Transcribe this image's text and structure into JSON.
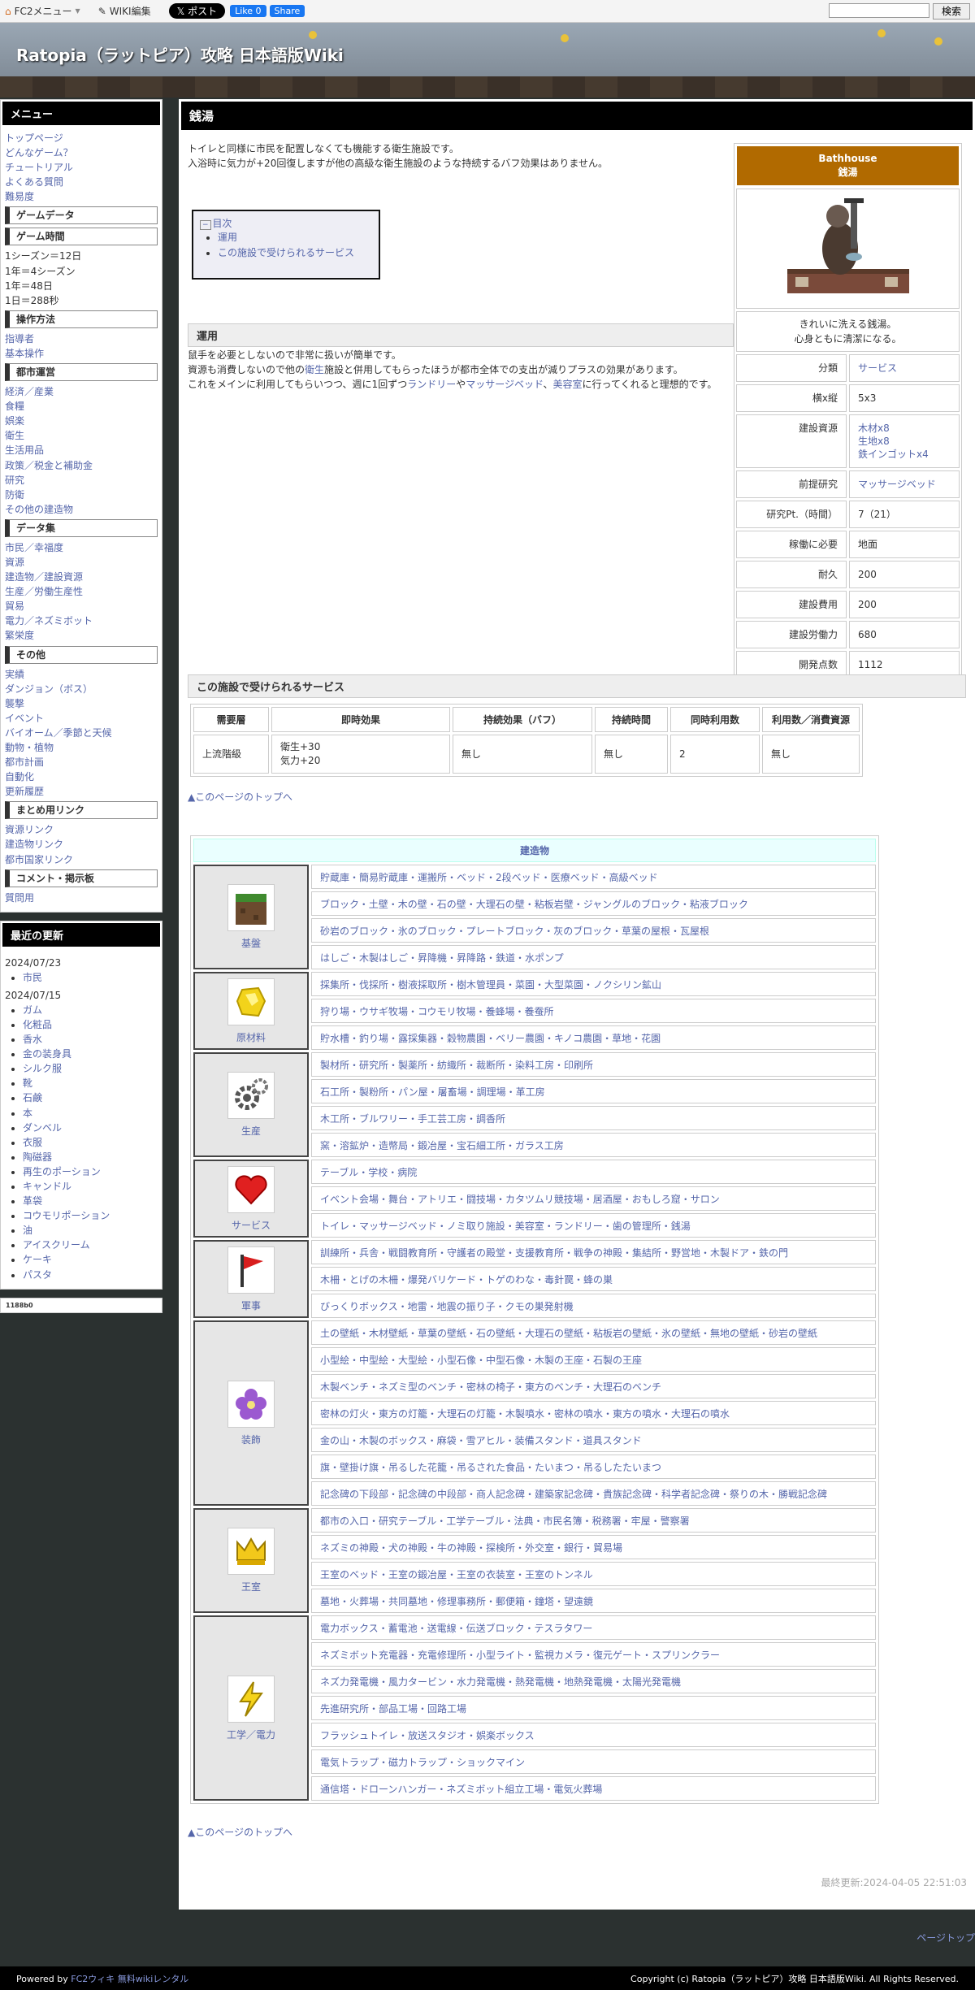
{
  "topbar": {
    "fc2_menu": "FC2メニュー",
    "wiki_edit": "WIKI編集",
    "x_post": "𝕏 ポスト",
    "fb_like": "Like 0",
    "fb_share": "Share",
    "search_button": "検索",
    "search_placeholder": ""
  },
  "site": {
    "title": "Ratopia（ラットピア）攻略 日本語版Wiki"
  },
  "sidebar": {
    "menu_title": "メニュー",
    "groups": [
      {
        "heading": "",
        "items": [
          "トップページ",
          "どんなゲーム？",
          "チュートリアル",
          "よくある質問",
          "難易度"
        ]
      },
      {
        "heading": "ゲームデータ",
        "items": []
      },
      {
        "heading": "ゲーム時間",
        "plain": [
          "1シーズン＝12日",
          "1年＝4シーズン",
          "1年＝48日",
          "1日＝288秒"
        ]
      },
      {
        "heading": "操作方法",
        "items": [
          "指導者",
          "基本操作"
        ]
      },
      {
        "heading": "都市運営",
        "items": [
          "経済／産業",
          "食糧",
          "娯楽",
          "衛生",
          "生活用品",
          "政策／税金と補助金",
          "研究",
          "防衛",
          "その他の建造物"
        ]
      },
      {
        "heading": "データ集",
        "items": [
          "市民／幸福度",
          "資源",
          "建造物／建設資源",
          "生産／労働生産性",
          "貿易",
          "電力／ネズミボット",
          "繁栄度"
        ]
      },
      {
        "heading": "その他",
        "items": [
          "実績",
          "ダンジョン（ボス）",
          "襲撃",
          "イベント",
          "バイオーム／季節と天候",
          "動物・植物",
          "都市計画",
          "自動化",
          "更新履歴"
        ]
      },
      {
        "heading": "まとめ用リンク",
        "items": [
          "資源リンク",
          "建造物リンク",
          "都市国家リンク"
        ]
      },
      {
        "heading": "コメント・掲示板",
        "items": [
          "質問用"
        ]
      }
    ],
    "updates_title": "最近の更新",
    "updates": [
      {
        "date": "2024/07/23",
        "items": [
          "市民"
        ]
      },
      {
        "date": "2024/07/15",
        "items": [
          "ガム",
          "化粧品",
          "香水",
          "金の装身具",
          "シルク服",
          "靴",
          "石鹸",
          "本",
          "ダンベル",
          "衣服",
          "陶磁器",
          "再生のポーション",
          "キャンドル",
          "革袋",
          "コウモリポーション",
          "油",
          "アイスクリーム",
          "ケーキ",
          "パスタ"
        ]
      }
    ],
    "counter": "1188b0"
  },
  "page": {
    "title": "銭湯",
    "intro": [
      "トイレと同様に市民を配置しなくても機能する衛生施設です。",
      "入浴時に気力が+20回復しますが他の高級な衛生施設のような持続するバフ効果はありません。"
    ],
    "toc_label": "目次",
    "toc": [
      "運用",
      "この施設で受けられるサービス"
    ],
    "sec1_title": "運用",
    "sec1_lines": [
      {
        "pre": "鼠手を必要としないので非常に扱いが簡単です。",
        "link": "",
        "post": ""
      },
      {
        "pre": "資源も消費しないので他の",
        "link": "衛生",
        "post": "施設と併用してもらったほうが都市全体での支出が減りプラスの効果があります。"
      }
    ],
    "sec1_line3": {
      "a": "これをメインに利用してもらいつつ、週に1回ずつ",
      "b": "ランドリー",
      "c": "や",
      "d": "マッサージベッド",
      "e": "、",
      "f": "美容室",
      "g": "に行ってくれると理想的です。"
    },
    "sec2_title": "この施設で受けられるサービス",
    "back_to_top": "▲このページのトップへ",
    "last_modified": "最終更新:2024-04-05 22:51:03"
  },
  "infobox": {
    "title_en": "Bathhouse",
    "title_jp": "銭湯",
    "desc": [
      "きれいに洗える銭湯。",
      "心身ともに清潔になる。"
    ],
    "rows": [
      {
        "k": "分類",
        "v": "サービス",
        "link": true
      },
      {
        "k": "横x縦",
        "v": "5x3",
        "link": false
      },
      {
        "k": "建設資源",
        "v": "木材x8\n生地x8\n鉄インゴットx4",
        "link": true
      },
      {
        "k": "前提研究",
        "v": "マッサージベッド",
        "link": true
      },
      {
        "k": "研究Pt.（時間）",
        "v": "7（21）",
        "link": false
      },
      {
        "k": "稼働に必要",
        "v": "地面",
        "link": false
      },
      {
        "k": "耐久",
        "v": "200",
        "link": false
      },
      {
        "k": "建設費用",
        "v": "200",
        "link": false
      },
      {
        "k": "建設労働力",
        "v": "680",
        "link": false
      },
      {
        "k": "開発点数",
        "v": "1112",
        "link": false
      }
    ]
  },
  "service_table": {
    "headers": [
      "需要層",
      "即時効果",
      "持続効果（バフ）",
      "持続時間",
      "同時利用数",
      "利用数／消費資源"
    ],
    "row": [
      "上流階級",
      "衛生+30\n気力+20",
      "無し",
      "無し",
      "2",
      "無し"
    ]
  },
  "nav": {
    "title": "建造物",
    "categories": [
      {
        "name": "基盤",
        "icon": "dirt-block-icon",
        "rows": [
          "貯蔵庫・簡易貯蔵庫・運搬所・ベッド・2段ベッド・医療ベッド・高級ベッド",
          "ブロック・土壁・木の壁・石の壁・大理石の壁・粘板岩壁・ジャングルのブロック・粘液ブロック",
          "砂岩のブロック・氷のブロック・プレートブロック・灰のブロック・草葉の屋根・瓦屋根",
          "はしご・木製はしご・昇降機・昇降路・鉄道・水ポンプ"
        ]
      },
      {
        "name": "原材料",
        "icon": "gold-ore-icon",
        "rows": [
          "採集所・伐採所・樹液採取所・樹木管理員・菜園・大型菜園・ノクシリン鉱山",
          "狩り場・ウサギ牧場・コウモリ牧場・養蜂場・養蚕所",
          "貯水槽・釣り場・露採集器・穀物農園・ベリー農園・キノコ農園・草地・花園"
        ]
      },
      {
        "name": "生産",
        "icon": "gears-icon",
        "rows": [
          "製材所・研究所・製薬所・紡織所・裁断所・染料工房・印刷所",
          "石工所・製粉所・パン屋・屠畜場・調理場・革工房",
          "木工所・ブルワリー・手工芸工房・調香所",
          "窯・溶鉱炉・造幣局・鍛冶屋・宝石細工所・ガラス工房"
        ]
      },
      {
        "name": "サービス",
        "icon": "heart-icon",
        "rows": [
          "テーブル・学校・病院",
          "イベント会場・舞台・アトリエ・闘技場・カタツムリ競技場・居酒屋・おもしろ窟・サロン",
          "トイレ・マッサージベッド・ノミ取り施設・美容室・ランドリー・歯の管理所・銭湯"
        ]
      },
      {
        "name": "軍事",
        "icon": "red-flag-icon",
        "rows": [
          "訓練所・兵舎・戦闘教育所・守護者の殿堂・支援教育所・戦争の神殿・集結所・野営地・木製ドア・鉄の門",
          "木柵・とげの木柵・爆発バリケード・トゲのわな・毒針罠・蜂の巣",
          "びっくりボックス・地雷・地震の振り子・クモの巣発射機"
        ]
      },
      {
        "name": "装飾",
        "icon": "purple-flower-icon",
        "rows": [
          "土の壁紙・木材壁紙・草葉の壁紙・石の壁紙・大理石の壁紙・粘板岩の壁紙・氷の壁紙・無地の壁紙・砂岩の壁紙",
          "小型絵・中型絵・大型絵・小型石像・中型石像・木製の王座・石製の王座",
          "木製ベンチ・ネズミ型のベンチ・密林の椅子・東方のベンチ・大理石のベンチ",
          "密林の灯火・東方の灯籠・大理石の灯籠・木製噴水・密林の噴水・東方の噴水・大理石の噴水",
          "金の山・木製のボックス・麻袋・雪アヒル・装備スタンド・道具スタンド",
          "旗・壁掛け旗・吊るした花籠・吊るされた食品・たいまつ・吊るしたたいまつ",
          "記念碑の下段部・記念碑の中段部・商人記念碑・建築家記念碑・貴族記念碑・科学者記念碑・祭りの木・勝戦記念碑"
        ]
      },
      {
        "name": "王室",
        "icon": "crown-icon",
        "rows": [
          "都市の入口・研究テーブル・工学テーブル・法典・市民名簿・税務署・牢屋・警察署",
          "ネズミの神殿・犬の神殿・牛の神殿・探検所・外交室・銀行・貿易場",
          "王室のベッド・王室の鍛冶屋・王室の衣装室・王室のトンネル",
          "墓地・火葬場・共同墓地・修理事務所・郵便箱・鐘塔・望遠鏡"
        ]
      },
      {
        "name": "工学／電力",
        "icon": "lightning-icon",
        "rows": [
          "電力ボックス・蓄電池・送電線・伝送ブロック・テスラタワー",
          "ネズミボット充電器・充電修理所・小型ライト・監視カメラ・復元ゲート・スプリンクラー",
          "ネズ力発電機・風力タービン・水力発電機・熱発電機・地熱発電機・太陽光発電機",
          "先進研究所・部品工場・回路工場",
          "フラッシュトイレ・放送スタジオ・娯楽ボックス",
          "電気トラップ・磁力トラップ・ショックマイン",
          "通信塔・ドローンハンガー・ネズミボット組立工場・電気火葬場"
        ]
      }
    ]
  },
  "footer": {
    "powered_pre": "Powered by",
    "powered_link": "FC2ウィキ 無料wikiレンタル",
    "copyright": "Copyright (c) Ratopia（ラットピア）攻略 日本語版Wiki. All Rights Reserved.",
    "pagetop": "ページトップ"
  }
}
